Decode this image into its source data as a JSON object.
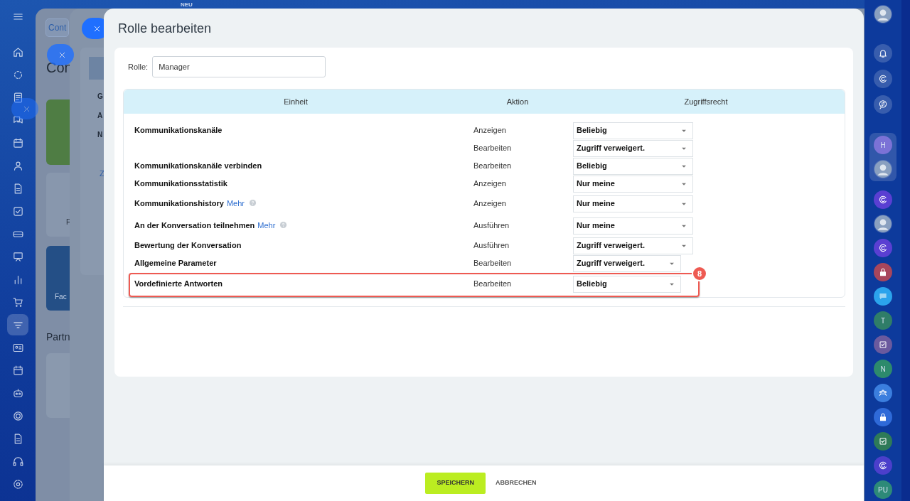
{
  "top_badge": "NEU",
  "left_nav": [
    {
      "kind": "menu",
      "selected": false
    },
    {
      "kind": "home",
      "selected": false
    },
    {
      "kind": "dots",
      "selected": false
    },
    {
      "kind": "form",
      "selected": false
    },
    {
      "kind": "chat",
      "selected": false
    },
    {
      "kind": "calendar",
      "selected": false
    },
    {
      "kind": "people",
      "selected": false
    },
    {
      "kind": "document",
      "selected": false
    },
    {
      "kind": "checkbox",
      "selected": false
    },
    {
      "kind": "tray",
      "selected": false
    },
    {
      "kind": "board",
      "selected": false
    },
    {
      "kind": "chart",
      "selected": false
    },
    {
      "kind": "cart",
      "selected": false
    },
    {
      "kind": "filter",
      "selected": true
    },
    {
      "kind": "card",
      "selected": false
    },
    {
      "kind": "calendar",
      "selected": false
    },
    {
      "kind": "robot",
      "selected": false
    },
    {
      "kind": "target",
      "selected": false
    },
    {
      "kind": "document",
      "selected": false
    },
    {
      "kind": "headset",
      "selected": false
    },
    {
      "kind": "gear",
      "selected": false
    }
  ],
  "back_window_1": {
    "tab": "Cont",
    "title": "Con",
    "tile_label": "F",
    "tile_label_2": "Fac",
    "section": "Partn"
  },
  "back_window_2": {
    "rows": [
      "G",
      "A",
      "N"
    ],
    "link": "Z"
  },
  "modal": {
    "title": "Rolle bearbeiten",
    "role_label": "Rolle:",
    "role_value": "Manager",
    "columns": [
      "Einheit",
      "Aktion",
      "Zugriffsrecht"
    ],
    "rows": [
      {
        "entity": "Kommunikationskanäle",
        "action": "Anzeigen",
        "access": "Beliebig",
        "compact": false,
        "highlighted": false
      },
      {
        "action": "Bearbeiten",
        "access": "Zugriff verweigert.",
        "compact": false,
        "highlighted": false
      },
      {
        "entity": "Kommunikationskanäle verbinden",
        "action": "Bearbeiten",
        "access": "Beliebig",
        "compact": false,
        "highlighted": false
      },
      {
        "entity": "Kommunikationsstatistik",
        "action": "Anzeigen",
        "access": "Nur meine",
        "compact": false,
        "highlighted": false
      },
      {
        "entity": "Kommunikationshistory",
        "more_link": "Mehr",
        "action": "Anzeigen",
        "access": "Nur meine",
        "compact": false,
        "highlighted": false
      },
      {
        "entity": "An der Konversation teilnehmen",
        "more_link": "Mehr",
        "action": "Ausführen",
        "access": "Nur meine",
        "compact": false,
        "highlighted": false
      },
      {
        "entity": "Bewertung der Konversation",
        "action": "Ausführen",
        "access": "Zugriff verweigert.",
        "compact": false,
        "highlighted": false
      },
      {
        "entity": "Allgemeine Parameter",
        "action": "Bearbeiten",
        "access": "Zugriff verweigert.",
        "compact": true,
        "highlighted": false
      },
      {
        "entity": "Vordefinierte Antworten",
        "action": "Bearbeiten",
        "access": "Beliebig",
        "compact": true,
        "highlighted": true,
        "callout": "8"
      }
    ],
    "buttons": [
      "SPEICHERN",
      "ABBRECHEN"
    ]
  },
  "right_bar": [
    {
      "kind": "photo"
    },
    {
      "kind": "bell"
    },
    {
      "kind": "swirl"
    },
    {
      "kind": "chat-arrows"
    },
    {
      "kind": "letter",
      "text": "H",
      "color": "#7b72d6",
      "grouped": true
    },
    {
      "kind": "photo",
      "grouped": true
    },
    {
      "kind": "swirl",
      "color": "#5a3fd2"
    },
    {
      "kind": "photo"
    },
    {
      "kind": "swirl",
      "color": "#5a3fd2"
    },
    {
      "kind": "lock",
      "color": "#a8465c"
    },
    {
      "kind": "chat",
      "color": "#2ba3ec"
    },
    {
      "kind": "letter",
      "text": "T",
      "color": "#2f7d68"
    },
    {
      "kind": "check",
      "color": "#6a5a9e"
    },
    {
      "kind": "letter",
      "text": "N",
      "color": "#2d8a6c"
    },
    {
      "kind": "people",
      "color": "#3b7ede"
    },
    {
      "kind": "lock",
      "color": "#2f6ad8"
    },
    {
      "kind": "check",
      "color": "#2e7a58"
    },
    {
      "kind": "swirl",
      "color": "#4b3fcb"
    },
    {
      "kind": "letter",
      "text": "PU",
      "color": "#2d8a78"
    }
  ]
}
